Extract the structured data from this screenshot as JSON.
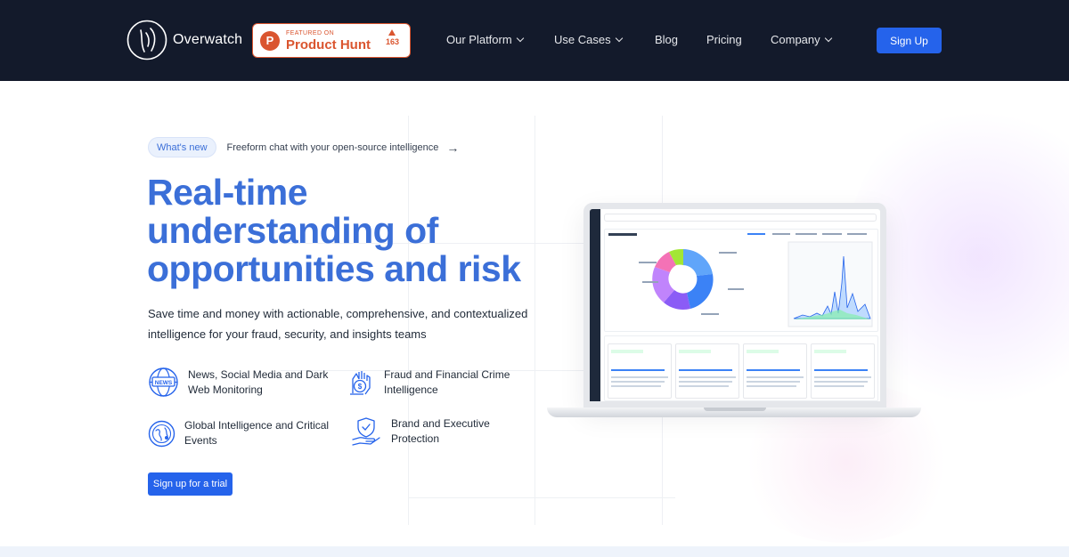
{
  "nav": {
    "brand": "Overwatch",
    "product_hunt": {
      "featured": "FEATURED ON",
      "name": "Product Hunt",
      "votes": "163",
      "brand_color": "#da552f"
    },
    "items": [
      {
        "label": "Our Platform",
        "has_dropdown": true
      },
      {
        "label": "Use Cases",
        "has_dropdown": true
      },
      {
        "label": "Blog",
        "has_dropdown": false
      },
      {
        "label": "Pricing",
        "has_dropdown": false
      },
      {
        "label": "Company",
        "has_dropdown": true
      }
    ],
    "signup_label": "Sign Up",
    "background": "#131a2b",
    "accent": "#2563eb"
  },
  "hero": {
    "badge": "What's new",
    "announcement": "Freeform chat with your open-source intelligence",
    "announcement_arrow": "→",
    "headline": "Real-time understanding of opportunities and risk",
    "subtext": "Save time and money with actionable, comprehensive, and contextualized intelligence for your fraud, security, and insights teams",
    "headline_color": "#3b6fd8",
    "features": [
      {
        "icon": "news-globe-icon",
        "label": "News, Social Media and Dark Web Monitoring"
      },
      {
        "icon": "fraud-money-icon",
        "label": "Fraud and Financial Crime Intelligence"
      },
      {
        "icon": "globe-critical-icon",
        "label": "Global Intelligence and Critical Events"
      },
      {
        "icon": "shield-hand-icon",
        "label": "Brand and Executive Protection"
      }
    ],
    "cta_label": "Sign up for a trial"
  }
}
